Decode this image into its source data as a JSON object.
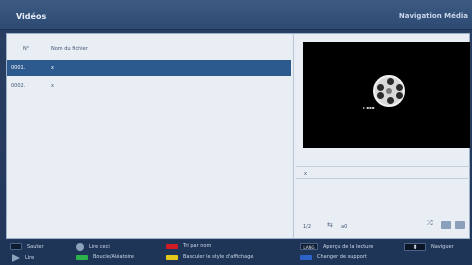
{
  "header": {
    "title": "Vidéos",
    "section": "Navigation Média"
  },
  "list": {
    "col_number": "N°",
    "col_filename": "Nom du fichier",
    "rows": [
      {
        "num": "0001.",
        "name": "x",
        "selected": true
      },
      {
        "num": "0002.",
        "name": "x",
        "selected": false
      }
    ]
  },
  "preview": {
    "tag": "▸ ▪▪▪",
    "filename": "x"
  },
  "status": {
    "page": "1/2",
    "device": "a0"
  },
  "footer": {
    "jump": "Sauter",
    "play_this": "Lire ceci",
    "sort_by_name": "Tri par nom",
    "lang_key": "LANG",
    "playback_preview": "Aperçu de la lecture",
    "navigate": "Naviguer",
    "play": "Lire",
    "loop_random": "Boucle/Aléatoire",
    "toggle_display": "Basculer le style d'affichage",
    "change_source": "Changer de support"
  },
  "colors": {
    "red": "#d11c28",
    "green": "#2bb24a",
    "yellow": "#e4c81b",
    "blue": "#2d63c9",
    "selection": "#2c5a8f"
  }
}
